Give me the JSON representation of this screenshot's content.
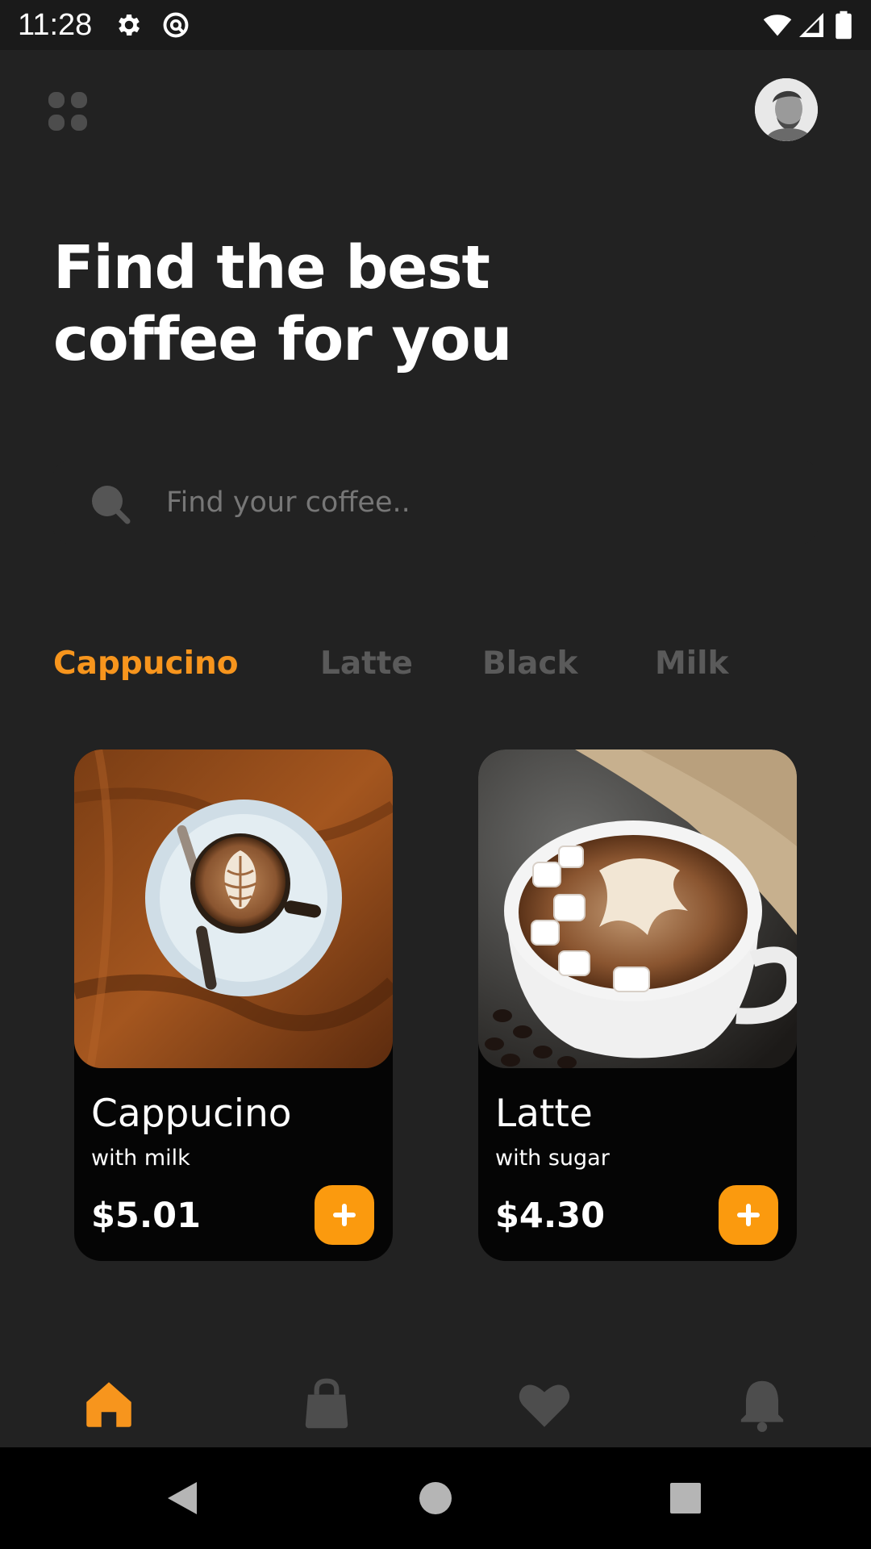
{
  "status_bar": {
    "time": "11:28",
    "icons": [
      "settings-icon",
      "sync-icon",
      "wifi-icon",
      "cell-signal-icon",
      "battery-icon"
    ]
  },
  "header": {
    "menu_icon": "grid-menu-icon",
    "avatar": "user-avatar"
  },
  "headline": {
    "line1": "Find the best",
    "line2": "coffee for you"
  },
  "search": {
    "placeholder": "Find your coffee..",
    "value": ""
  },
  "categories": [
    {
      "label": "Cappucino",
      "active": true
    },
    {
      "label": "Latte",
      "active": false
    },
    {
      "label": "Black",
      "active": false
    },
    {
      "label": "Milk",
      "active": false
    }
  ],
  "products": [
    {
      "name": "Cappucino",
      "subtitle": "with milk",
      "price": "$5.01"
    },
    {
      "name": "Latte",
      "subtitle": "with sugar",
      "price": "$4.30"
    }
  ],
  "bottom_nav": [
    {
      "icon": "home-icon",
      "active": true
    },
    {
      "icon": "bag-icon",
      "active": false
    },
    {
      "icon": "heart-icon",
      "active": false
    },
    {
      "icon": "bell-icon",
      "active": false
    }
  ],
  "colors": {
    "background": "#222222",
    "accent": "#f7951d",
    "card": "#050505",
    "inactive": "#5a5a5a"
  }
}
